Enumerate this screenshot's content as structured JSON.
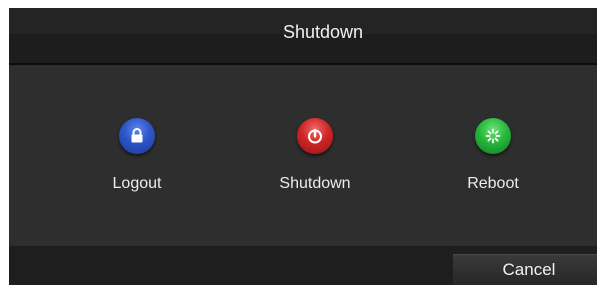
{
  "dialog": {
    "title": "Shutdown"
  },
  "actions": [
    {
      "label": "Logout",
      "icon": "lock-icon",
      "color": "#2b55c9"
    },
    {
      "label": "Shutdown",
      "icon": "power-icon",
      "color": "#cf2525"
    },
    {
      "label": "Reboot",
      "icon": "restart-icon",
      "color": "#25b83a"
    }
  ],
  "footer": {
    "cancel_label": "Cancel"
  }
}
